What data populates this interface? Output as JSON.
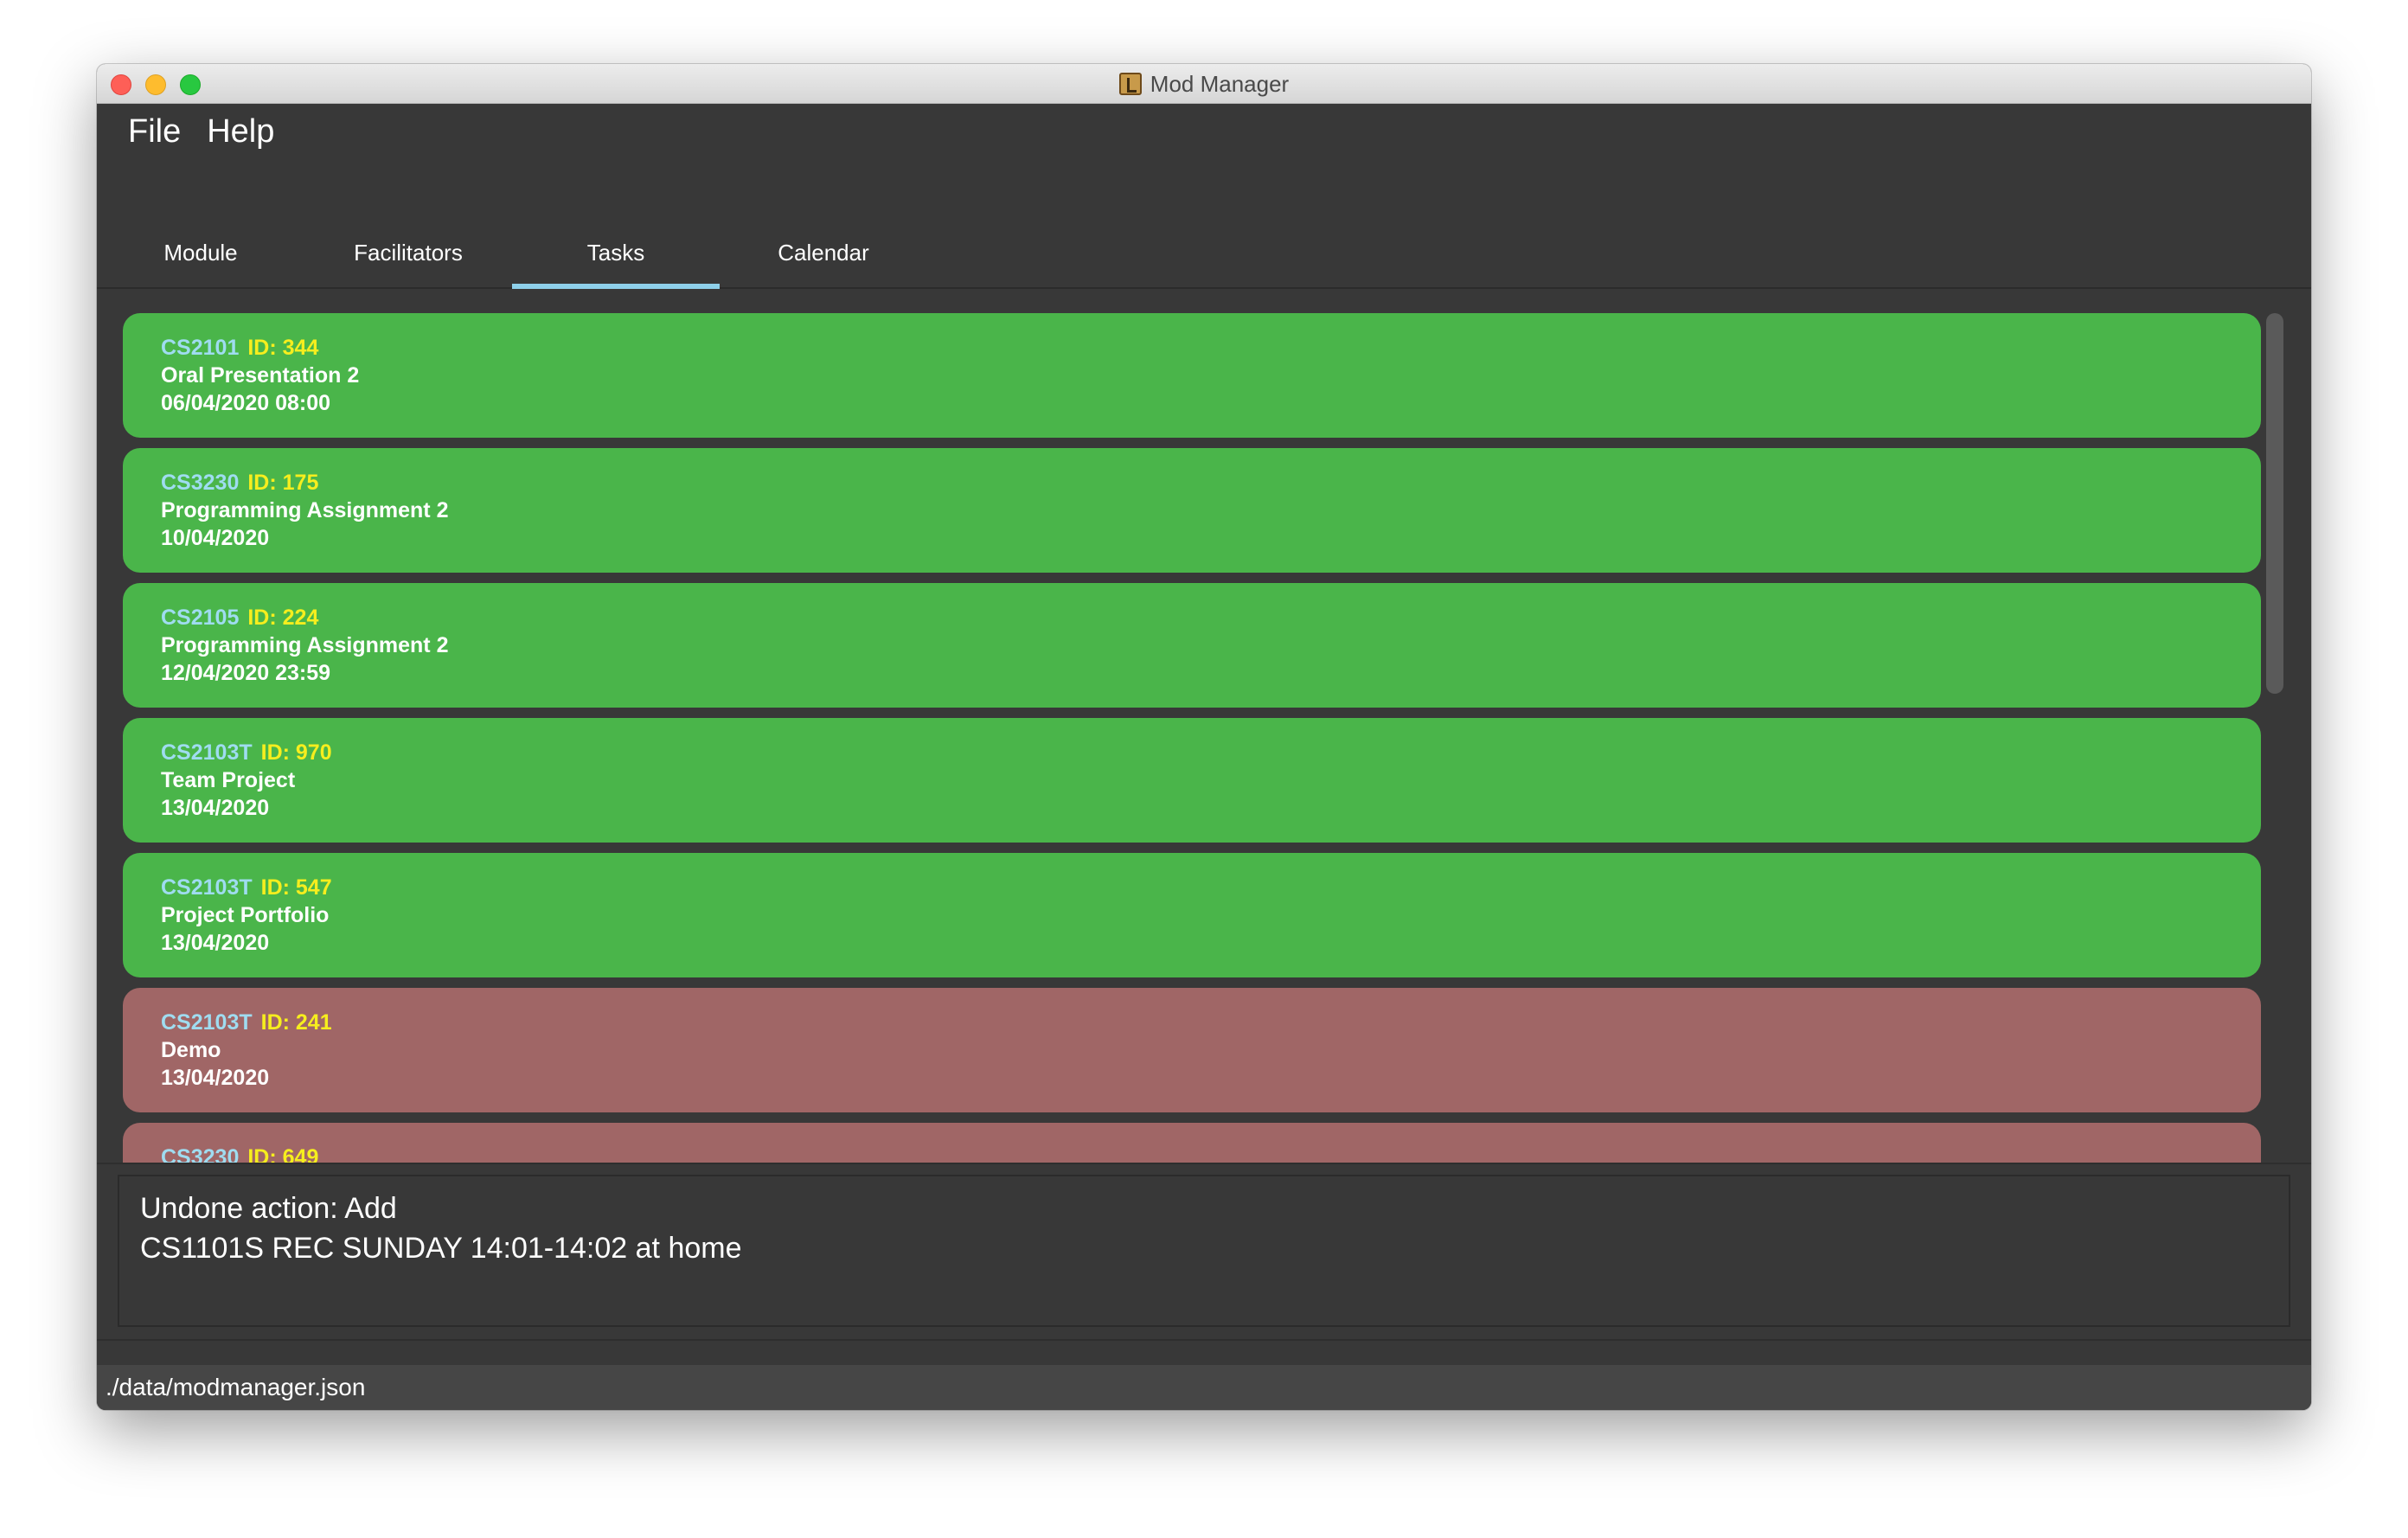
{
  "window": {
    "title": "Mod Manager"
  },
  "menu": {
    "items": [
      "File",
      "Help"
    ]
  },
  "tabs": [
    {
      "label": "Module",
      "active": false
    },
    {
      "label": "Facilitators",
      "active": false
    },
    {
      "label": "Tasks",
      "active": true
    },
    {
      "label": "Calendar",
      "active": false
    }
  ],
  "tasks": [
    {
      "module": "CS2101",
      "id": "ID: 344",
      "description": "Oral Presentation 2",
      "time": "06/04/2020 08:00",
      "status": "done"
    },
    {
      "module": "CS3230",
      "id": "ID: 175",
      "description": "Programming Assignment 2",
      "time": "10/04/2020",
      "status": "done"
    },
    {
      "module": "CS2105",
      "id": "ID: 224",
      "description": "Programming Assignment 2",
      "time": "12/04/2020 23:59",
      "status": "done"
    },
    {
      "module": "CS2103T",
      "id": "ID: 970",
      "description": "Team Project",
      "time": "13/04/2020",
      "status": "done"
    },
    {
      "module": "CS2103T",
      "id": "ID: 547",
      "description": "Project Portfolio",
      "time": "13/04/2020",
      "status": "done"
    },
    {
      "module": "CS2103T",
      "id": "ID: 241",
      "description": "Demo",
      "time": "13/04/2020",
      "status": "pending"
    },
    {
      "module": "CS3230",
      "id": "ID: 649",
      "description": "",
      "time": "",
      "status": "pending"
    }
  ],
  "result": {
    "line1": "Undone action: Add",
    "line2": "CS1101S REC SUNDAY 14:01-14:02 at home"
  },
  "command": {
    "value": ""
  },
  "status_bar": {
    "path": "./data/modmanager.json"
  },
  "colors": {
    "done": "#4ab54a",
    "pending": "#a06666",
    "module_code": "#9fdcf0",
    "task_id": "#f6ee1e",
    "active_tab": "#8ed0ea"
  }
}
